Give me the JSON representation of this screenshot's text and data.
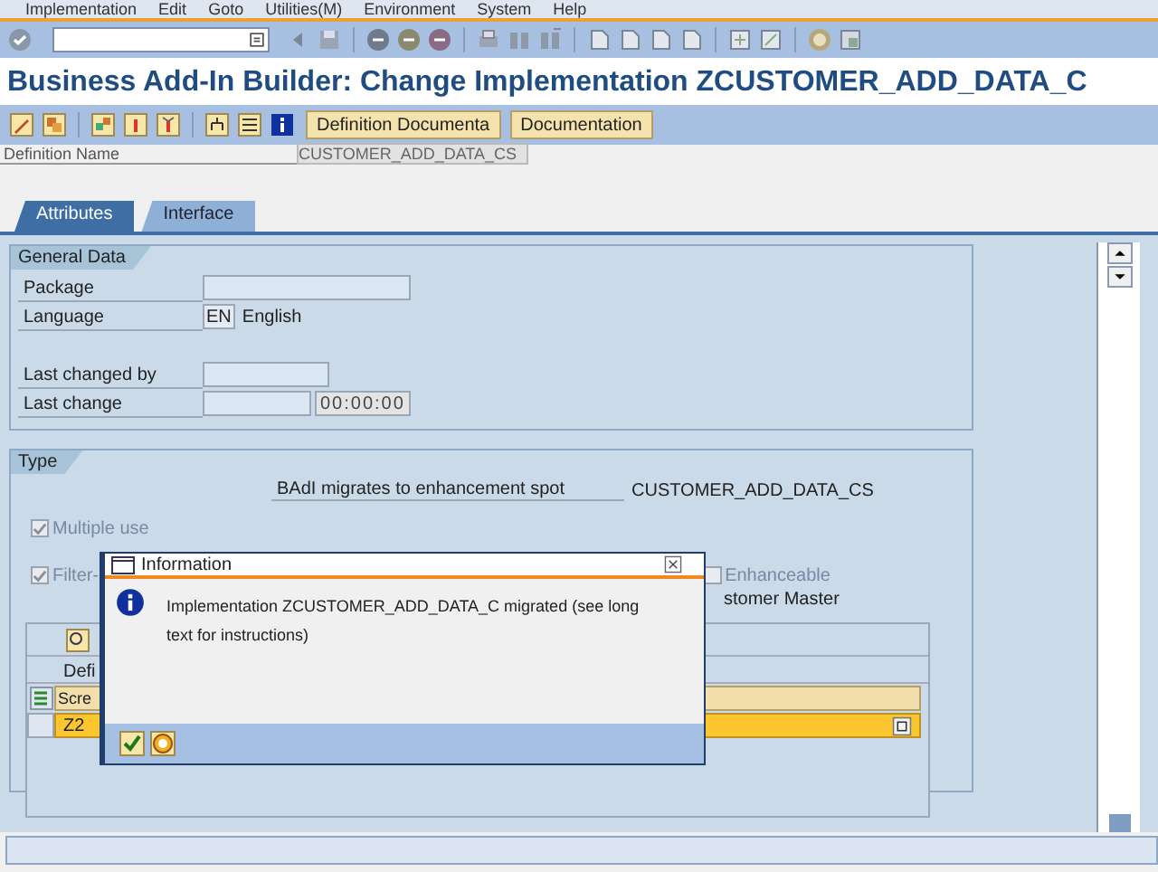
{
  "menu_bar": [
    "Implementation",
    "Edit",
    "Goto",
    "Utilities(M)",
    "Environment",
    "System",
    "Help"
  ],
  "title": "Business Add-In Builder: Change Implementation ZCUSTOMER_ADD_DATA_C",
  "app_toolbar": {
    "buttons": [
      "Definition Documenta",
      "Documentation"
    ]
  },
  "definition_name": {
    "label": "Definition Name",
    "value": "CUSTOMER_ADD_DATA_CS"
  },
  "tabs": [
    {
      "label": "Attributes",
      "selected": true
    },
    {
      "label": "Interface",
      "selected": false
    }
  ],
  "general_data": {
    "title": "General Data",
    "fields": [
      {
        "label": "Package",
        "kind": "field"
      },
      {
        "label": "Language",
        "kind": "lang",
        "code": "EN",
        "value": "English"
      },
      {
        "kind": "gap"
      },
      {
        "label": "Last changed by",
        "kind": "short"
      },
      {
        "label": "Last change",
        "kind": "datetime",
        "time": "00:00:00"
      }
    ]
  },
  "type": {
    "title": "Type",
    "spot_label": "BAdI migrates to enhancement spot",
    "spot_value": "CUSTOMER_ADD_DATA_CS",
    "multiple_use": {
      "label": "Multiple use",
      "checked": true
    },
    "filter": {
      "label": "Filter-",
      "checked": true
    },
    "enhanceable": {
      "label": "Enhanceable",
      "checked": false
    },
    "filter_text": "stomer Master",
    "table": {
      "heading": "Defi",
      "column": "Scre",
      "rows": [
        "Z2"
      ]
    }
  },
  "dialog": {
    "title": "Information",
    "message": "Implementation ZCUSTOMER_ADD_DATA_C migrated (see long text for instructions)"
  }
}
